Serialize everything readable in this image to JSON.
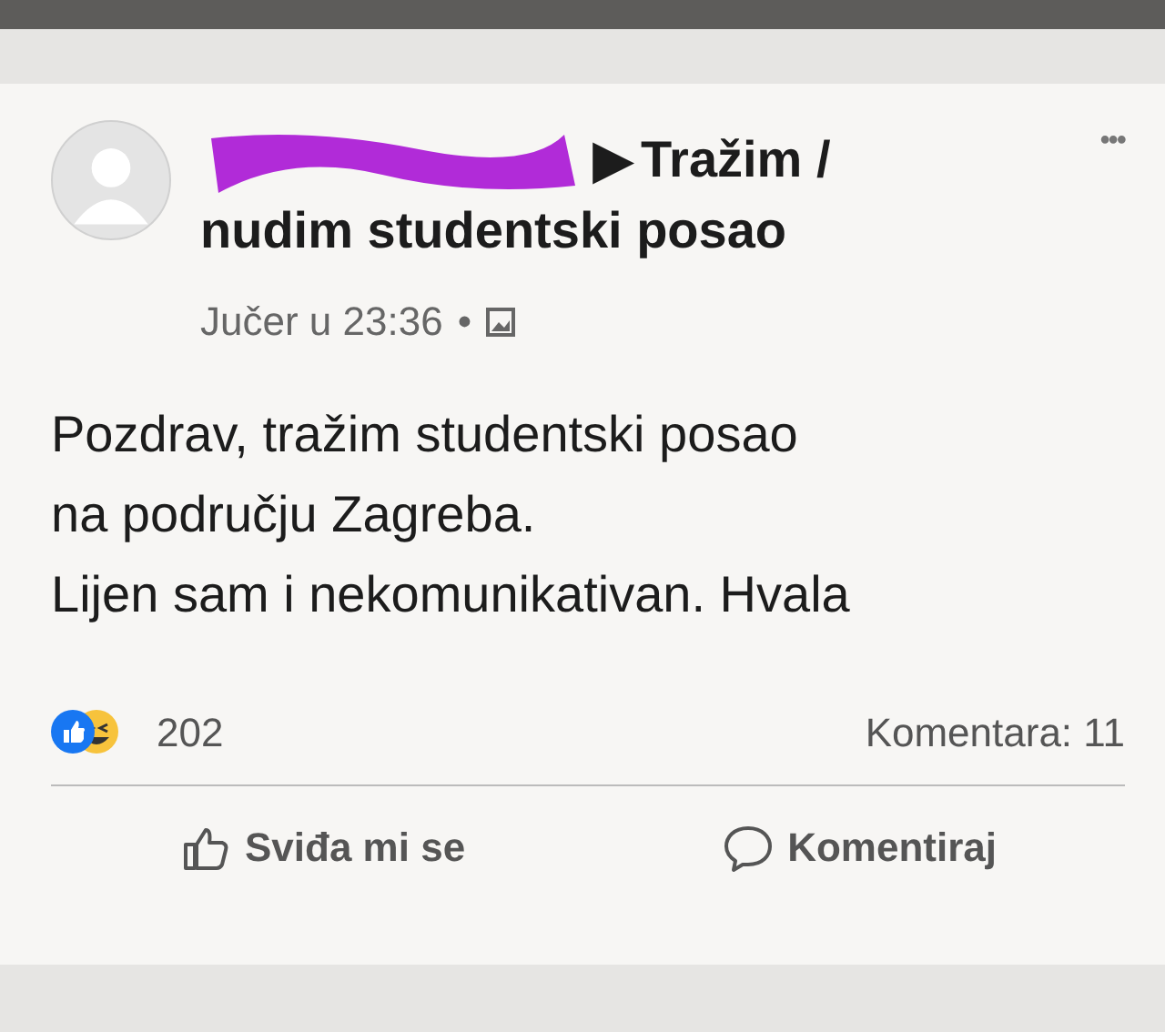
{
  "post": {
    "group_arrow": "▶",
    "group_lines": [
      "Tražim /",
      "nudim studentski posao"
    ],
    "time": "Jučer u 23:36",
    "separator": "•",
    "menu": "•••",
    "text": [
      "Pozdrav, tražim studentski posao",
      "na području Zagreba.",
      "Lijen sam i nekomunikativan. Hvala"
    ],
    "reaction_count": "202",
    "comments": "Komentara: 11"
  },
  "actions": [
    {
      "label": "Sviđa mi se",
      "kind": "like"
    },
    {
      "label": "Komentiraj",
      "kind": "comment"
    }
  ]
}
